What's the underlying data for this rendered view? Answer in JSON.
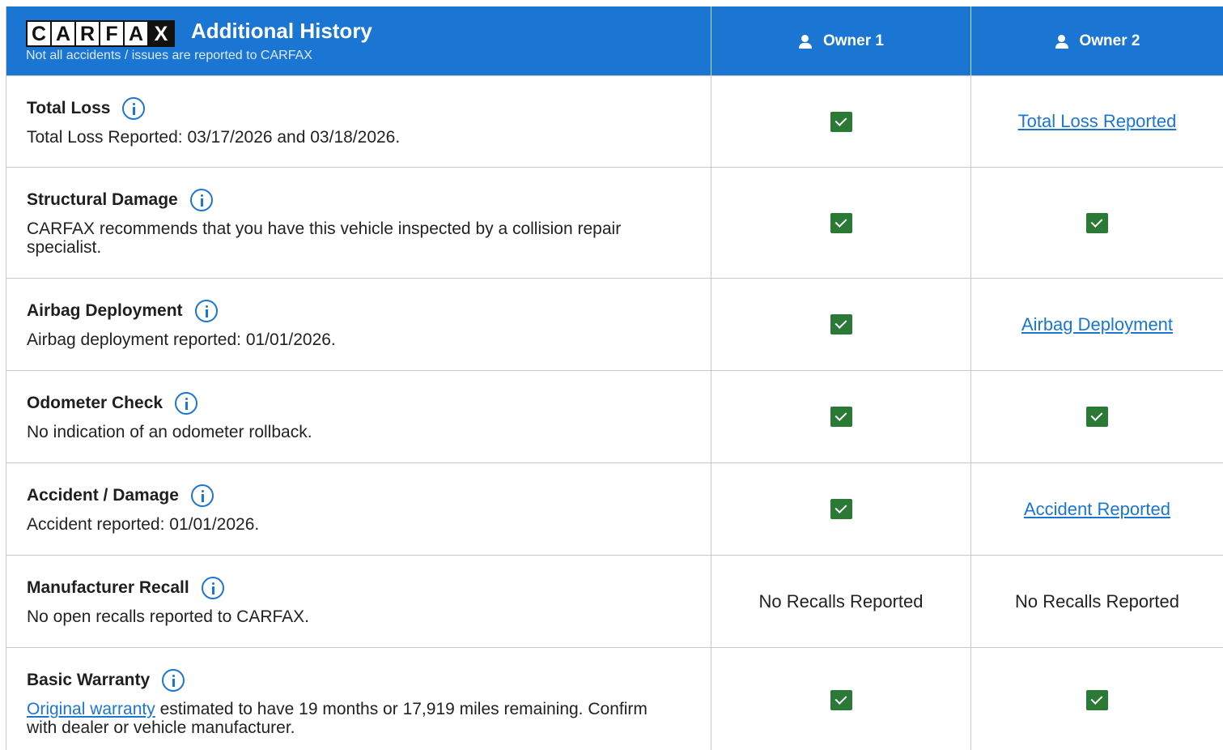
{
  "header": {
    "logo_letters": [
      "C",
      "A",
      "R",
      "F",
      "A",
      "X"
    ],
    "title": "Additional History",
    "subtitle": "Not all accidents / issues are reported to CARFAX",
    "owner1": "Owner 1",
    "owner2": "Owner 2"
  },
  "colors": {
    "header_bg": "#1a76d2",
    "check_green": "#2a7a36",
    "link_blue": "#1a76d2"
  },
  "rows": [
    {
      "title": "Total Loss",
      "description": "Total Loss Reported: 03/17/2026 and 03/18/2026.",
      "owner1": {
        "type": "check"
      },
      "owner2": {
        "type": "link",
        "text": "Total Loss Reported"
      }
    },
    {
      "title": "Structural Damage",
      "description": "CARFAX recommends that you have this vehicle inspected by a collision repair specialist.",
      "owner1": {
        "type": "check"
      },
      "owner2": {
        "type": "check"
      }
    },
    {
      "title": "Airbag Deployment",
      "description": "Airbag deployment reported: 01/01/2026.",
      "owner1": {
        "type": "check"
      },
      "owner2": {
        "type": "link",
        "text": "Airbag Deployment"
      }
    },
    {
      "title": "Odometer Check",
      "description": "No indication of an odometer rollback.",
      "owner1": {
        "type": "check"
      },
      "owner2": {
        "type": "check"
      }
    },
    {
      "title": "Accident / Damage",
      "description": "Accident reported: 01/01/2026.",
      "owner1": {
        "type": "check"
      },
      "owner2": {
        "type": "link",
        "text": "Accident Reported"
      }
    },
    {
      "title": "Manufacturer Recall",
      "description": "No open recalls reported to CARFAX.",
      "owner1": {
        "type": "text",
        "text": "No Recalls Reported"
      },
      "owner2": {
        "type": "text",
        "text": "No Recalls Reported"
      }
    },
    {
      "title": "Basic Warranty",
      "description_link": "Original warranty",
      "description": " estimated to have 19 months or 17,919 miles remaining. Confirm with dealer or vehicle manufacturer.",
      "owner1": {
        "type": "check"
      },
      "owner2": {
        "type": "check"
      }
    }
  ]
}
